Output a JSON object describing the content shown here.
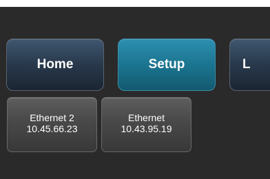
{
  "nav": {
    "home_label": "Home",
    "setup_label": "Setup",
    "next_label": "L"
  },
  "interfaces": [
    {
      "name": "Ethernet 2",
      "ip": "10.45.66.23"
    },
    {
      "name": "Ethernet",
      "ip": "10.43.95.19"
    }
  ]
}
